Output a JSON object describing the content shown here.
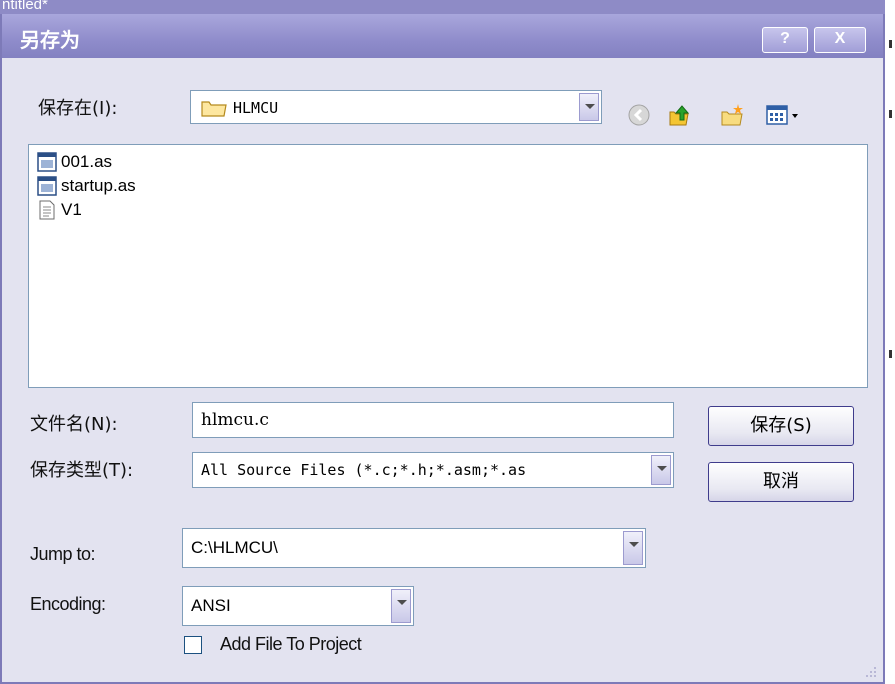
{
  "background_window": {
    "title": "ntitled*"
  },
  "dialog": {
    "title": "另存为",
    "help_button": "?",
    "close_button": "X"
  },
  "save_in": {
    "label": "保存在(I):",
    "value": "HLMCU"
  },
  "toolbar": {
    "back": "back-icon",
    "up": "up-folder-icon",
    "new_folder": "new-folder-icon",
    "views": "views-menu-icon"
  },
  "files": [
    {
      "name": "001.as",
      "icon": "source-file-icon"
    },
    {
      "name": "startup.as",
      "icon": "source-file-icon"
    },
    {
      "name": "V1",
      "icon": "text-file-icon"
    }
  ],
  "filename": {
    "label": "文件名(N):",
    "value": "hlmcu.c"
  },
  "filetype": {
    "label": "保存类型(T):",
    "value": "All Source Files (*.c;*.h;*.asm;*.as"
  },
  "buttons": {
    "save": "保存(S)",
    "cancel": "取消"
  },
  "jump_to": {
    "label": "Jump to:",
    "value": "C:\\HLMCU\\"
  },
  "encoding": {
    "label": "Encoding:",
    "value": "ANSI"
  },
  "add_to_project": {
    "label": "Add File To Project",
    "checked": false
  },
  "colors": {
    "titlebar": "#8f8ccb",
    "dialog_bg": "#e3e3f0",
    "border": "#7f9db9"
  }
}
